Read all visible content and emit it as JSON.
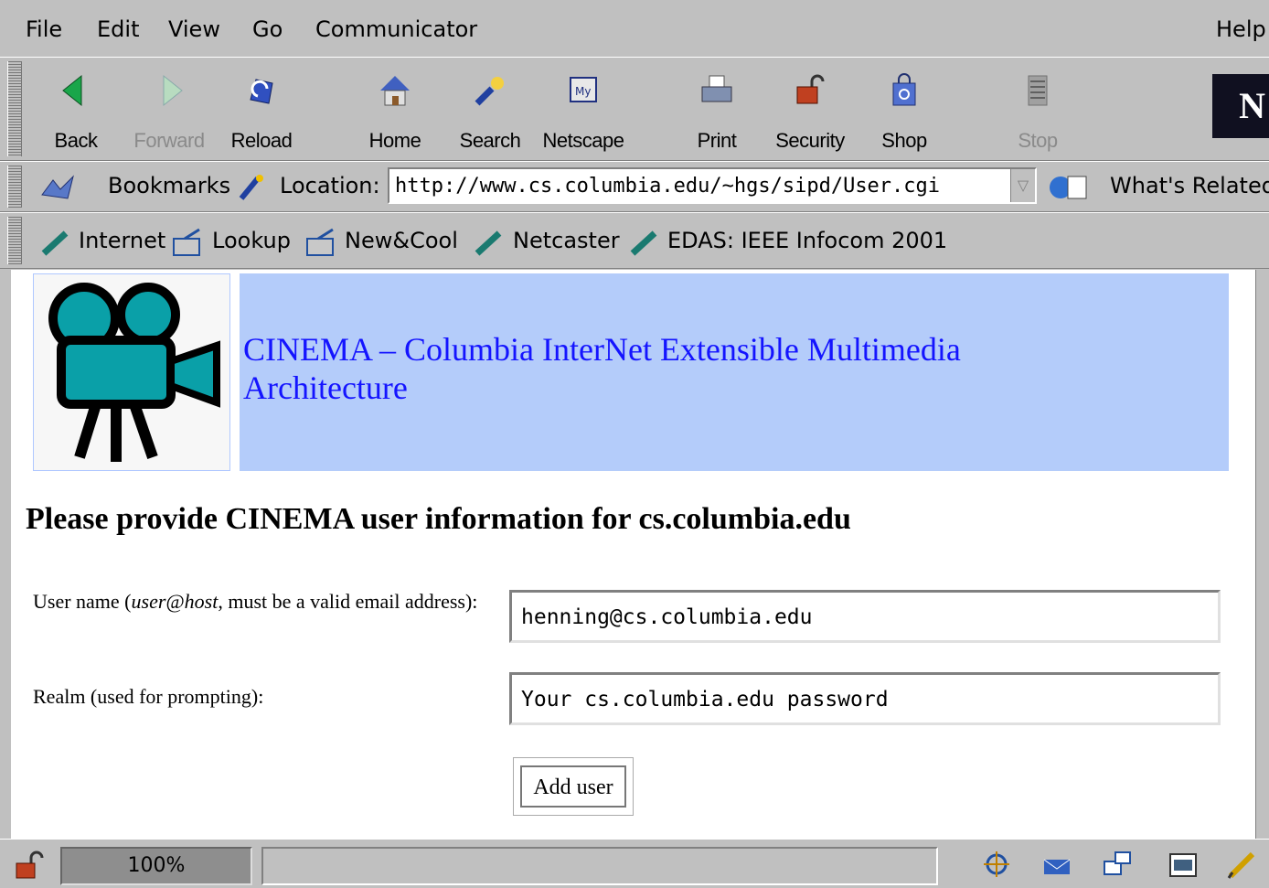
{
  "menu": [
    "File",
    "Edit",
    "View",
    "Go",
    "Communicator"
  ],
  "menu_help": "Help",
  "nav_buttons": [
    {
      "label": "Back",
      "icon": "back-arrow-icon"
    },
    {
      "label": "Forward",
      "icon": "forward-arrow-icon",
      "disabled": true
    },
    {
      "label": "Reload",
      "icon": "reload-icon"
    },
    {
      "label": "Home",
      "icon": "home-icon"
    },
    {
      "label": "Search",
      "icon": "search-icon"
    },
    {
      "label": "Netscape",
      "icon": "netscape-icon"
    },
    {
      "label": "Print",
      "icon": "printer-icon"
    },
    {
      "label": "Security",
      "icon": "padlock-icon"
    },
    {
      "label": "Shop",
      "icon": "shopping-bag-icon"
    },
    {
      "label": "Stop",
      "icon": "stop-icon",
      "disabled": true
    }
  ],
  "location": {
    "bookmarks": "Bookmarks",
    "label": "Location:",
    "url": "http://www.cs.columbia.edu/~hgs/sipd/User.cgi",
    "related": "What's Related"
  },
  "personal_toolbar": [
    "Internet",
    "Lookup",
    "New&Cool",
    "Netcaster",
    "EDAS: IEEE Infocom 2001"
  ],
  "page": {
    "banner_title": "CINEMA – Columbia InterNet Extensible Multimedia Architecture",
    "heading": "Please provide CINEMA user information for cs.columbia.edu",
    "username_label_1": "User name (",
    "username_label_em": "user@host",
    "username_label_2": ", must be a valid email address):",
    "username_value": "henning@cs.columbia.edu",
    "realm_label": "Realm (used for prompting):",
    "realm_value": "Your cs.columbia.edu password",
    "add_button": "Add user"
  },
  "status": {
    "zoom": "100%"
  }
}
